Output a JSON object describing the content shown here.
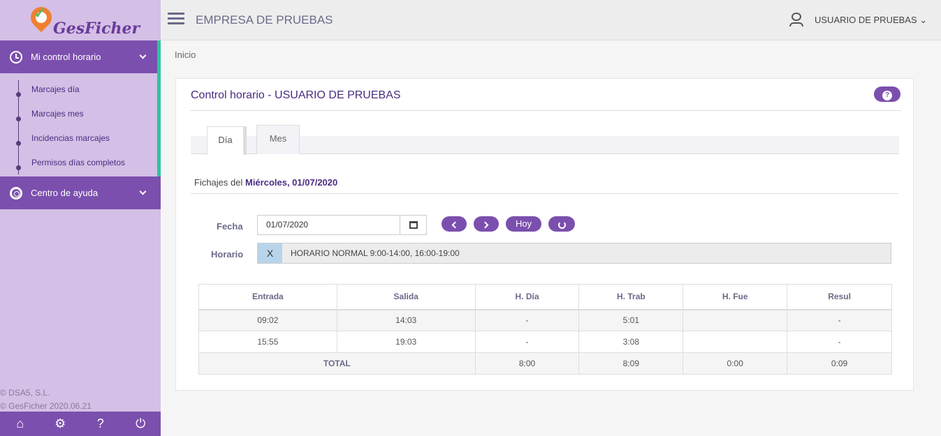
{
  "app": {
    "logo_text": "GesFicher",
    "company": "EMPRESA DE PRUEBAS",
    "user": "USUARIO DE PRUEBAS ⌄"
  },
  "sidebar": {
    "sections": [
      {
        "label": "Mi control horario",
        "items": [
          "Marcajes día",
          "Marcajes mes",
          "Incidencias marcajes",
          "Permisos días completos"
        ]
      },
      {
        "label": "Centro de ayuda"
      }
    ],
    "footer": [
      "© DSA5, S.L.",
      "© GesFicher 2020.06.21"
    ],
    "bottom_icons": [
      "home-icon",
      "gear-icon",
      "question-icon",
      "power-icon"
    ]
  },
  "breadcrumb": "Inicio",
  "panel": {
    "title": "Control horario - USUARIO DE PRUEBAS",
    "tabs": [
      {
        "label": "Día",
        "active": true
      },
      {
        "label": "Mes",
        "active": false
      }
    ],
    "fichajes_prefix": "Fichajes del ",
    "fichajes_date": "Miércoles, 01/07/2020",
    "fecha_label": "Fecha",
    "fecha_value": "01/07/2020",
    "hoy_label": "Hoy",
    "horario_label": "Horario",
    "horario_x": "X",
    "horario_value": "HORARIO NORMAL 9:00-14:00, 16:00-19:00"
  },
  "table": {
    "columns": [
      "Entrada",
      "Salida",
      "H. Día",
      "H. Trab",
      "H. Fue",
      "Resul"
    ],
    "rows": [
      [
        "09:02",
        "14:03",
        "-",
        "5:01",
        "",
        "-"
      ],
      [
        "15:55",
        "19:03",
        "-",
        "3:08",
        "",
        "-"
      ]
    ],
    "total": {
      "label": "TOTAL",
      "h_dia": "8:00",
      "h_trab": "8:09",
      "h_fue": "0:00",
      "resul": "0:09"
    }
  },
  "colors": {
    "accent": "#7b4fae",
    "sidebar_bg": "#d4bfe6",
    "active_marker": "#2ec4a0"
  }
}
